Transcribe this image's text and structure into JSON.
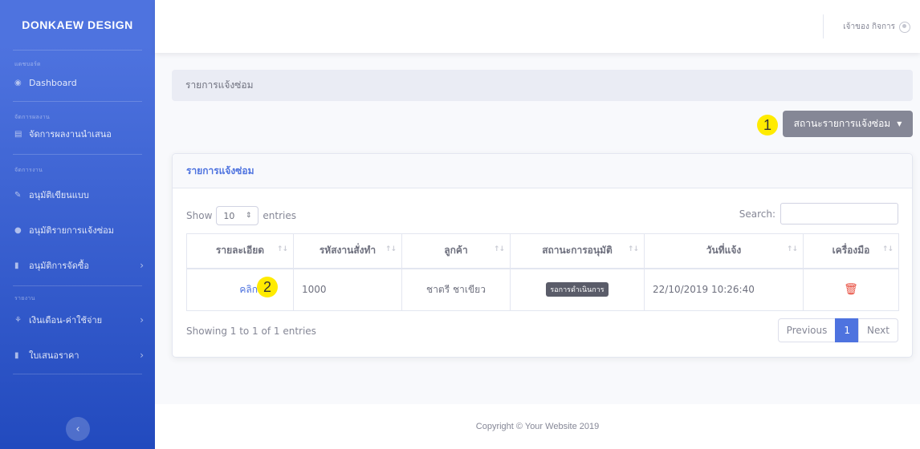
{
  "brand": "DONKAEW DESIGN",
  "sidebar": {
    "sections": [
      {
        "heading": "แดชบอร์ด",
        "items": [
          {
            "label": "Dashboard",
            "icon": "tachometer-icon",
            "chevron": false
          }
        ]
      },
      {
        "heading": "จัดการผลงาน",
        "items": [
          {
            "label": "จัดการผลงานนำเสนอ",
            "icon": "table-icon",
            "chevron": false
          }
        ]
      },
      {
        "heading": "จัดการงาน",
        "items": [
          {
            "label": "อนุมัติเขียนแบบ",
            "icon": "pencil-icon",
            "chevron": false
          },
          {
            "label": "อนุมัติรายการแจ้งซ่อม",
            "icon": "comment-icon",
            "chevron": false
          },
          {
            "label": "อนุมัติการจัดซื้อ",
            "icon": "file-icon",
            "chevron": true
          }
        ]
      },
      {
        "heading": "รายงาน",
        "items": [
          {
            "label": "เงินเดือน-ค่าใช้จ่าย",
            "icon": "hand-money-icon",
            "chevron": true
          },
          {
            "label": "ใบเสนอราคา",
            "icon": "file-icon",
            "chevron": true
          }
        ]
      }
    ],
    "toggle_icon": "chevron-left-icon"
  },
  "topbar": {
    "user_name": "เจ้าของ กิจการ",
    "avatar_icon": "user-circle-icon"
  },
  "breadcrumb": "รายการแจ้งซ่อม",
  "status_button": {
    "label": "สถานะรายการแจ้งซ่อม",
    "caret": "▼"
  },
  "markers": {
    "one": "1",
    "two": "2"
  },
  "card": {
    "title": "รายการแจ้งซ่อม",
    "show_label": "Show",
    "show_value": "10",
    "entries_label": "entries",
    "search_label": "Search:",
    "search_value": "",
    "columns": [
      "รายละเอียด",
      "รหัสงานสั่งทำ",
      "ลูกค้า",
      "สถานะการอนุมัติ",
      "วันที่แจ้ง",
      "เครื่องมือ"
    ],
    "rows": [
      {
        "detail": "คลิก",
        "code": "1000",
        "customer": "ชาตรี ชาเขียว",
        "status": "รอการดำเนินการ",
        "date": "22/10/2019 10:26:40",
        "tool_icon": "trash-icon"
      }
    ],
    "info": "Showing 1 to 1 of 1 entries",
    "pagination": {
      "previous": "Previous",
      "current": "1",
      "next": "Next"
    }
  },
  "footer": "Copyright © Your Website 2019",
  "colors": {
    "primary": "#4e73df",
    "secondary": "#858796",
    "danger": "#e74a3b",
    "marker": "#ffeb00"
  }
}
